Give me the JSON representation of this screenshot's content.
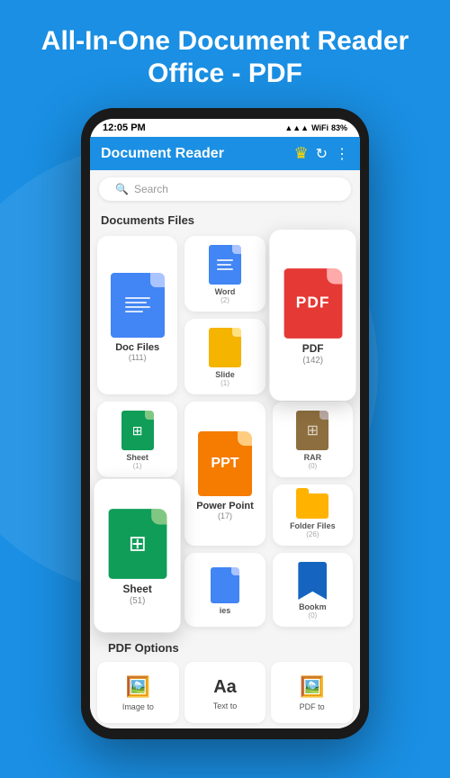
{
  "app": {
    "header_title": "All-In-One Document Reader Office - PDF",
    "status_time": "12:05 PM",
    "status_signal": "▲▲▲",
    "status_wifi": "WiFi",
    "status_battery": "83%",
    "app_bar_title": "Document Reader",
    "search_placeholder": "Search",
    "sections": {
      "documents": "Documents Files",
      "pdf_options": "PDF Options"
    },
    "doc_types": [
      {
        "id": "doc",
        "label": "Doc Files",
        "count": "(111)",
        "size": "large"
      },
      {
        "id": "word",
        "label": "Word",
        "count": "(2)",
        "size": "small"
      },
      {
        "id": "pdf",
        "label": "PDF",
        "count": "(142)",
        "size": "featured"
      },
      {
        "id": "slide",
        "label": "Slide",
        "count": "(1)",
        "size": "small"
      },
      {
        "id": "sheet_sm",
        "label": "Sheet",
        "count": "(1)",
        "size": "small"
      },
      {
        "id": "ppt",
        "label": "Power Point",
        "count": "(17)",
        "size": "large"
      },
      {
        "id": "rar",
        "label": "RAR",
        "count": "(0)",
        "size": "small"
      },
      {
        "id": "sheet_lg",
        "label": "Sheet",
        "count": "(51)",
        "size": "featured"
      },
      {
        "id": "folder",
        "label": "Folder Files",
        "count": "(26)",
        "size": "small"
      },
      {
        "id": "files",
        "label": "ies",
        "count": "",
        "size": "small"
      },
      {
        "id": "bookmark",
        "label": "Bookm",
        "count": "(0)",
        "size": "small"
      }
    ],
    "pdf_option_icons": [
      "🖼️",
      "Aa",
      "🖼️"
    ],
    "pdf_option_labels": [
      "Image to",
      "Text to",
      "PDF to"
    ]
  }
}
